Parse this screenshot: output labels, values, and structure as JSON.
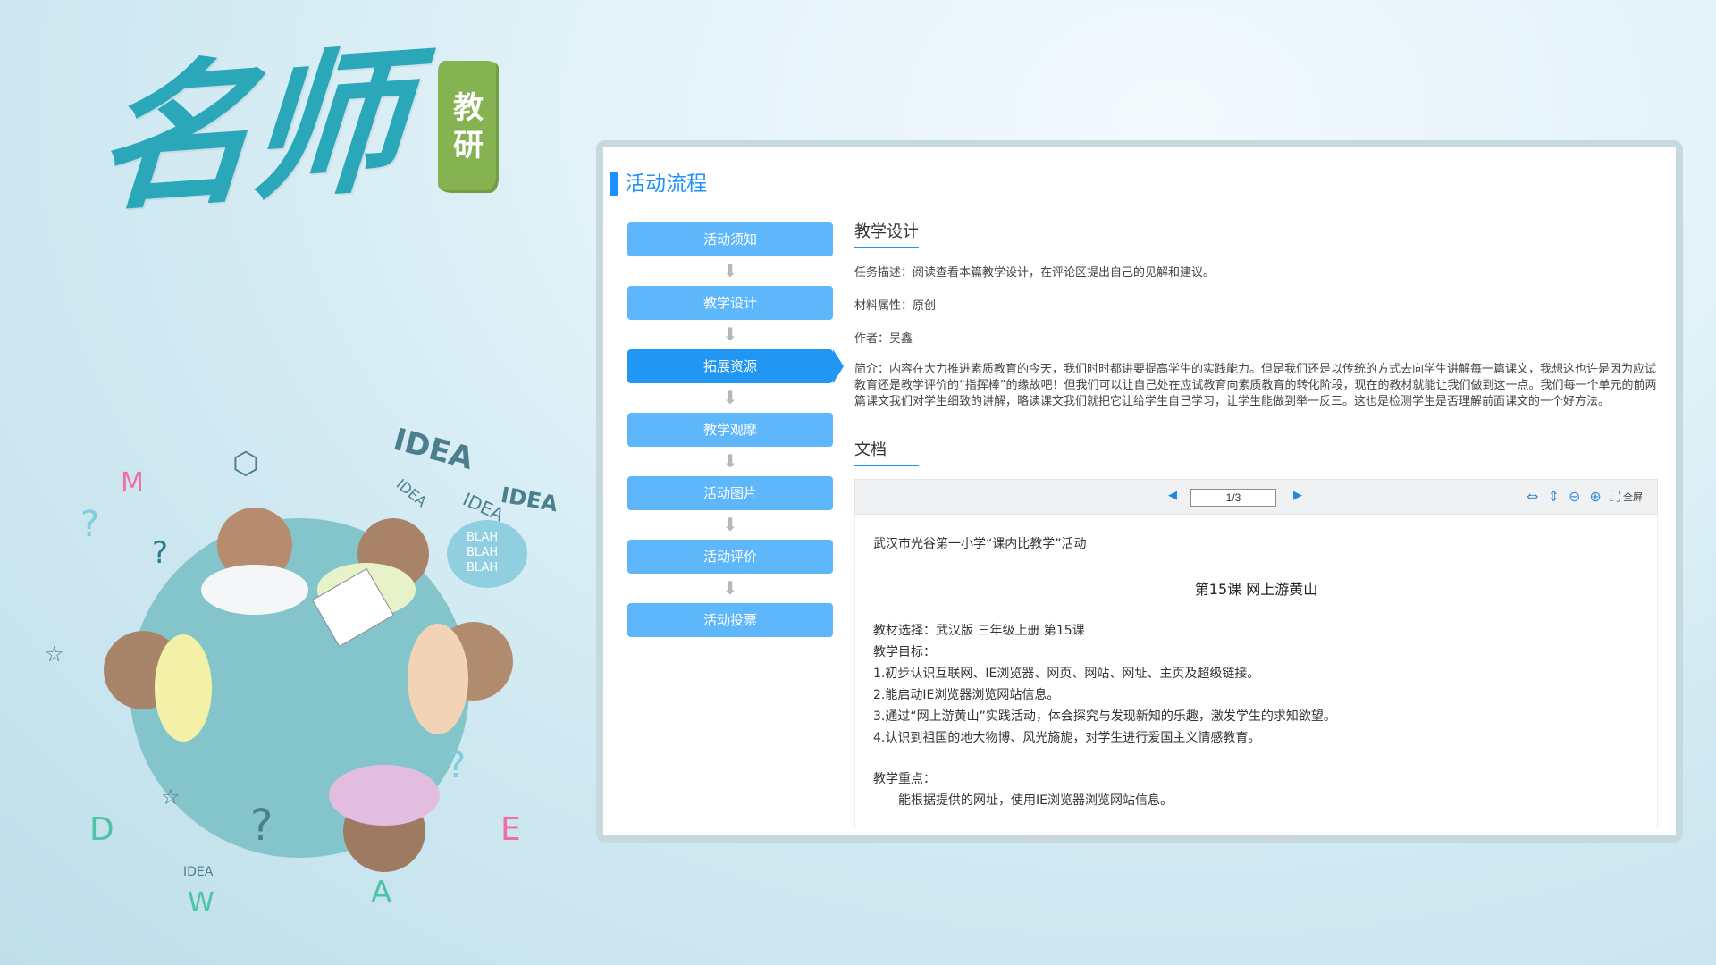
{
  "logo": {
    "script_text": "名师",
    "badge_chars": [
      "教",
      "研"
    ]
  },
  "colors": {
    "accent": "#1e90ff",
    "step_bg": "#5eb6fb",
    "step_active_bg": "#2196f3",
    "logo_teal": "#2aa7b9",
    "logo_green": "#86b351"
  },
  "panel": {
    "title": "活动流程"
  },
  "steps": [
    {
      "label": "活动须知",
      "active": false
    },
    {
      "label": "教学设计",
      "active": false
    },
    {
      "label": "拓展资源",
      "active": true
    },
    {
      "label": "教学观摩",
      "active": false
    },
    {
      "label": "活动图片",
      "active": false
    },
    {
      "label": "活动评价",
      "active": false
    },
    {
      "label": "活动投票",
      "active": false
    }
  ],
  "content": {
    "heading": "教学设计",
    "task": "任务描述：阅读查看本篇教学设计，在评论区提出自己的见解和建议。",
    "material": "材料属性：原创",
    "author": "作者：吴鑫",
    "intro": "简介：内容在大力推进素质教育的今天，我们时时都讲要提高学生的实践能力。但是我们还是以传统的方式去向学生讲解每一篇课文，我想这也许是因为应试教育还是教学评价的“指挥棒”的缘故吧！但我们可以让自己处在应试教育向素质教育的转化阶段，现在的教材就能让我们做到这一点。我们每一个单元的前两篇课文我们对学生细致的讲解，略读课文我们就把它让给学生自己学习，让学生能做到举一反三。这也是检测学生是否理解前面课文的一个好方法。",
    "doc_heading": "文档"
  },
  "viewer": {
    "prev_icon": "◀",
    "next_icon": "▶",
    "page": "1/3",
    "icons": [
      "fit-width-icon",
      "fit-height-icon",
      "zoom-out-icon",
      "zoom-in-icon",
      "fullscreen-icon"
    ],
    "fullscreen_label": "全屏"
  },
  "document": {
    "activity": "武汉市光谷第一小学“课内比教学”活动",
    "title": "第15课  网上游黄山",
    "textbook": "教材选择：武汉版   三年级上册   第15课",
    "goals_label": "教学目标：",
    "goals": [
      "1.初步认识互联网、IE浏览器、网页、网站、网址、主页及超级链接。",
      "2.能启动IE浏览器浏览网站信息。",
      "3.通过“网上游黄山”实践活动，体会探究与发现新知的乐趣，激发学生的求知欲望。",
      "4.认识到祖国的地大物博、风光旖旎，对学生进行爱国主义情感教育。"
    ],
    "key_label": "教学重点：",
    "key_point": "能根据提供的网址，使用IE浏览器浏览网站信息。"
  },
  "illustration": {
    "doodles": [
      "IDEA",
      "IDEA",
      "IDEA",
      "IDEA",
      "BLAH",
      "BLAH",
      "BLAH",
      "IDEA"
    ]
  }
}
